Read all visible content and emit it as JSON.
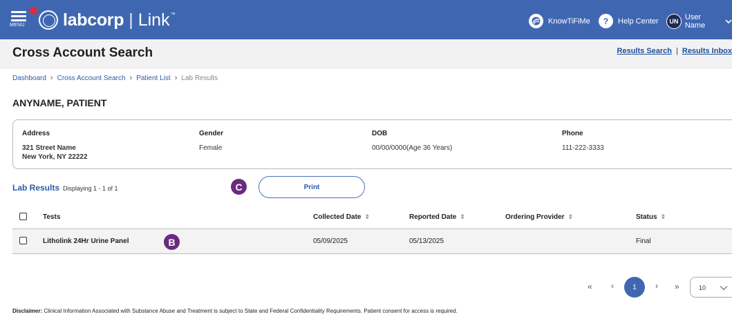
{
  "header": {
    "menu_label": "MENU",
    "brand": "labcorp",
    "product": "Link",
    "trademark": "™",
    "knowtifime": "KnowTiFiMe",
    "help_center": "Help Center",
    "user_initials": "UN",
    "user_name": "User Name"
  },
  "page": {
    "title": "Cross Account Search",
    "links": {
      "results_search": "Results Search",
      "separator": "|",
      "results_inbox": "Results Inbox"
    }
  },
  "breadcrumb": [
    "Dashboard",
    "Cross Account Search",
    "Patient List",
    "Lab Results"
  ],
  "patient": {
    "name": "ANYNAME, PATIENT",
    "address_label": "Address",
    "address_line1": "321 Street Name",
    "address_line2": "New York, NY 22222",
    "gender_label": "Gender",
    "gender": "Female",
    "dob_label": "DOB",
    "dob": "00/00/0000(Age 36 Years)",
    "phone_label": "Phone",
    "phone": "111-222-3333"
  },
  "results": {
    "title": "Lab Results",
    "displaying": "Displaying 1 - 1 of 1",
    "print_label": "Print",
    "columns": [
      "Tests",
      "Collected Date",
      "Reported Date",
      "Ordering Provider",
      "Status"
    ],
    "rows": [
      {
        "test": "Litholink 24Hr Urine Panel",
        "collected": "05/09/2025",
        "reported": "05/13/2025",
        "provider": "",
        "status": "Final"
      }
    ]
  },
  "markers": {
    "b": "B",
    "c": "C"
  },
  "pagination": {
    "first": "«",
    "prev": "‹",
    "current_page": "1",
    "next": "›",
    "last": "»",
    "page_size": "10"
  },
  "disclaimer": {
    "label": "Disclaimer:",
    "text": " Clinical Information Associated with Substance Abuse and Treatment is subject to State and Federal Confidentiality Requirements. Patient consent for access is required."
  },
  "icons": [
    "menu-icon",
    "notification-dot-icon",
    "labcorp-logo-icon",
    "knowtifime-icon",
    "help-icon",
    "chevron-down-icon",
    "sort-icon",
    "checkbox-icon"
  ],
  "colors": {
    "header_bg": "#3f67b1",
    "link": "#2c5aa6",
    "marker": "#6b2a80",
    "notification": "#e0293b"
  }
}
